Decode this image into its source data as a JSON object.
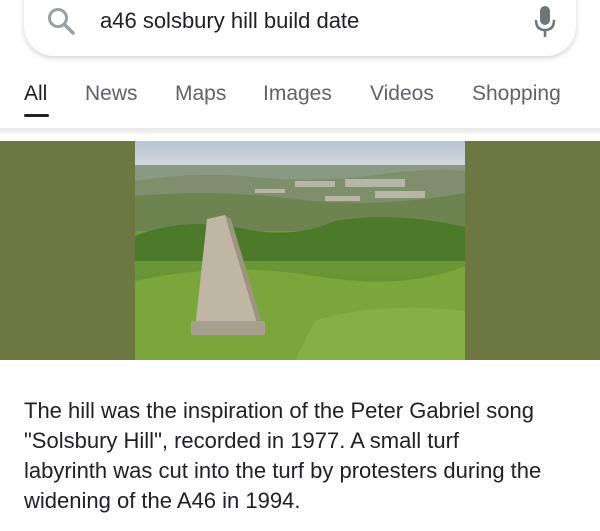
{
  "search": {
    "query": "a46 solsbury hill build date",
    "search_icon": "search-icon",
    "mic_icon": "microphone-icon"
  },
  "tabs": [
    {
      "label": "All",
      "active": true
    },
    {
      "label": "News",
      "active": false
    },
    {
      "label": "Maps",
      "active": false
    },
    {
      "label": "Images",
      "active": false
    },
    {
      "label": "Videos",
      "active": false
    },
    {
      "label": "Shopping",
      "active": false
    }
  ],
  "colors": {
    "panel_background": "#6d7742",
    "active_tab": "#202124",
    "inactive_tab": "#5f6368"
  },
  "description": {
    "lines": [
      "The hill was the inspiration of the Peter Gabriel song",
      "\"Solsbury Hill\", recorded in 1977. A small turf",
      "labyrinth was cut into the turf by protesters during the",
      "widening of the A46 in 1994."
    ]
  }
}
